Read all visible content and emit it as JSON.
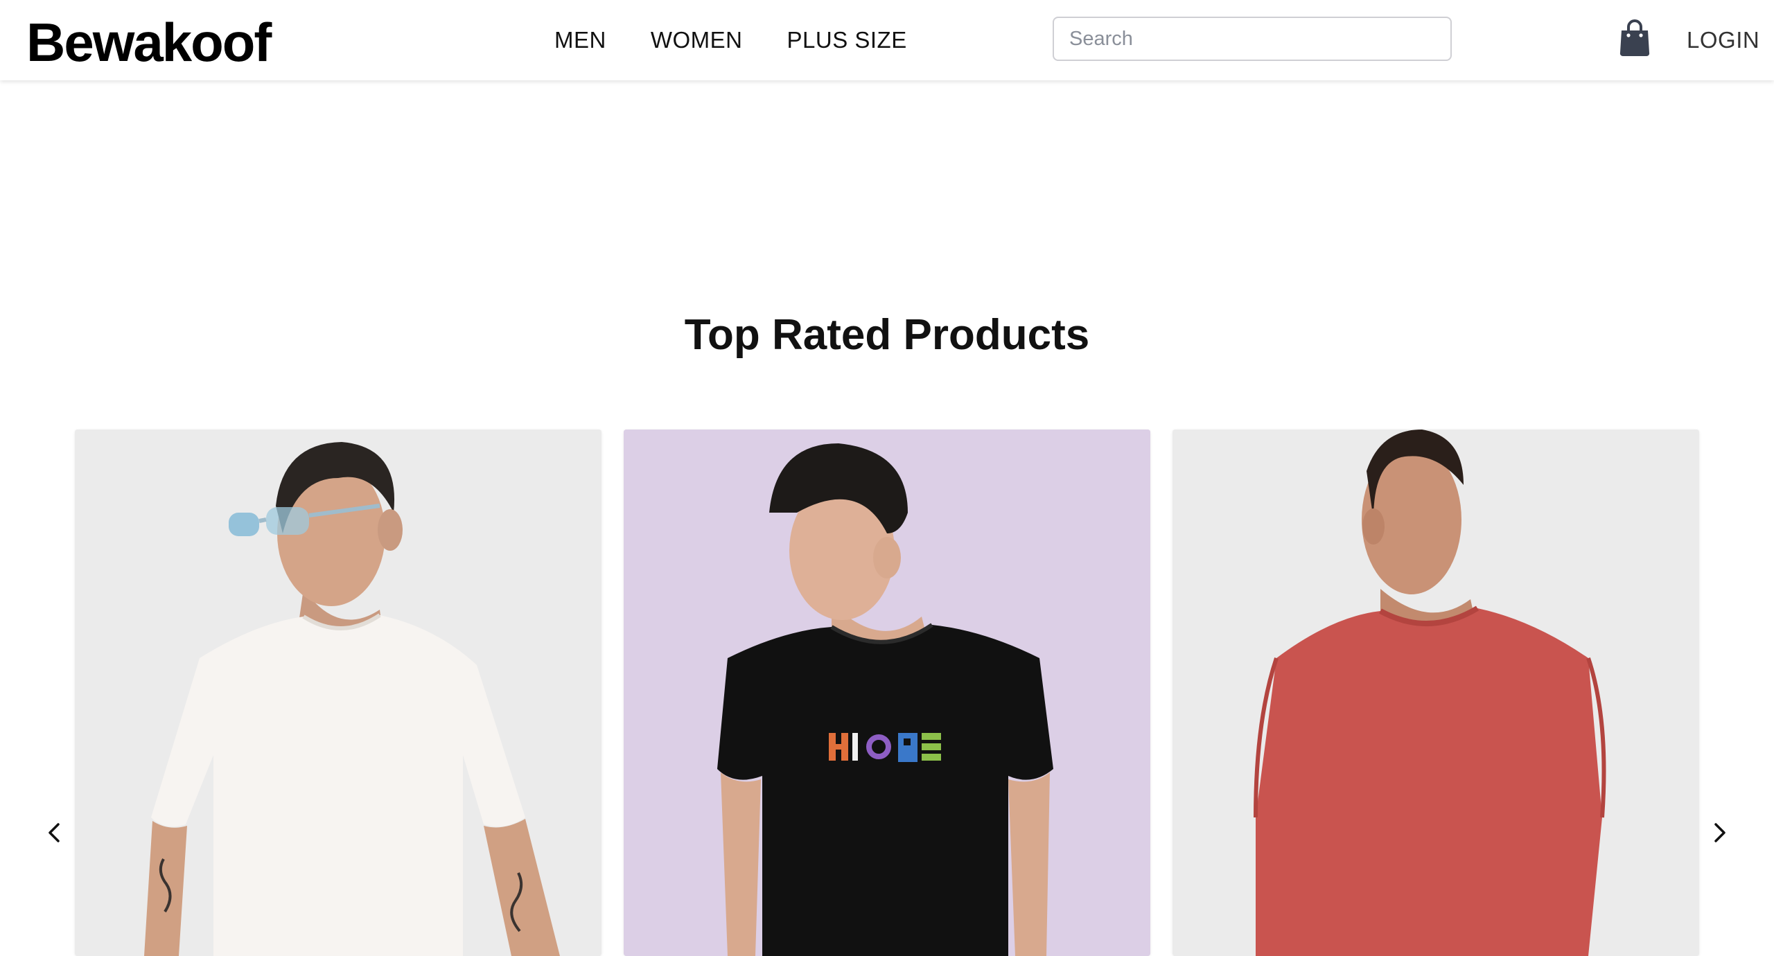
{
  "header": {
    "brand": "Bewakoof",
    "nav": [
      {
        "label": "MEN"
      },
      {
        "label": "WOMEN"
      },
      {
        "label": "PLUS SIZE"
      }
    ],
    "search": {
      "placeholder": "Search",
      "value": ""
    },
    "cart_icon": "shopping-bag-icon",
    "login_label": "LOGIN"
  },
  "section": {
    "title": "Top Rated Products"
  },
  "carousel": {
    "prev_icon": "chevron-left-icon",
    "next_icon": "chevron-right-icon",
    "products": [
      {
        "image": "man in white t-shirt with tinted glasses",
        "background": "#ebebeb",
        "tee_color": "#f7f4f1"
      },
      {
        "image": "man in black t-shirt with HOPE print",
        "background": "#dccfe6",
        "tee_color": "#111111",
        "print_text": "HOPE"
      },
      {
        "image": "man in red full-sleeve t-shirt",
        "background": "#ebebeb",
        "tee_color": "#c9544f"
      }
    ]
  },
  "colors": {
    "text": "#111111",
    "icon": "#3a4150",
    "border": "#cfcfd4"
  }
}
